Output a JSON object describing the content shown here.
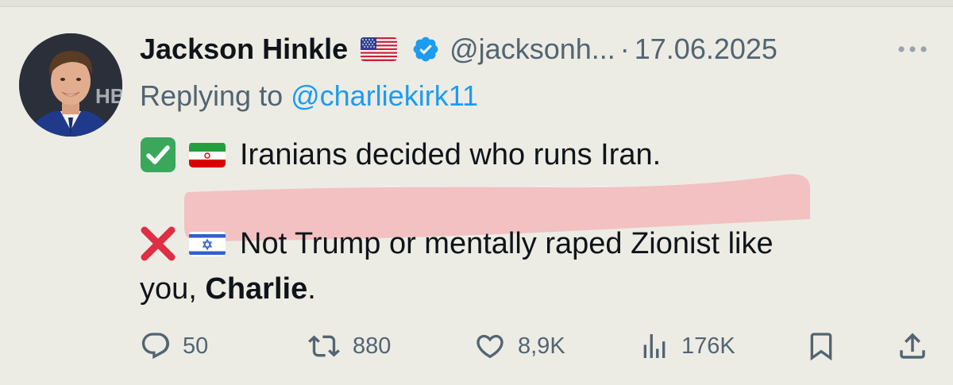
{
  "author": {
    "name": "Jackson Hinkle",
    "flag_icon": "us-flag-icon",
    "verified_icon": "verified-badge-icon",
    "handle": "@jacksonh...",
    "separator": "·",
    "date": "17.06.2025"
  },
  "reply": {
    "prefix": "Replying to ",
    "mention": "@charliekirk11"
  },
  "tweet": {
    "line1": {
      "emoji": "check-mark-button-icon",
      "flag": "iran-flag-icon",
      "text": "Iranians decided who runs Iran."
    },
    "line2": {
      "emoji": "cross-mark-icon",
      "flag": "israel-flag-icon",
      "text": "Not Trump or mentally raped Zionist like"
    },
    "line3": {
      "text_start": "you, ",
      "bold": "Charlie",
      "text_end": "."
    }
  },
  "actions": {
    "replies": "50",
    "retweets": "880",
    "likes": "8,9K",
    "views": "176K"
  },
  "colors": {
    "background": "#ecece5",
    "text": "#0f1419",
    "secondary": "#536471",
    "link": "#1d9bf0",
    "highlight": "#f4bcbc",
    "check_green": "#3aa75a",
    "cross_red": "#dd2e44"
  }
}
